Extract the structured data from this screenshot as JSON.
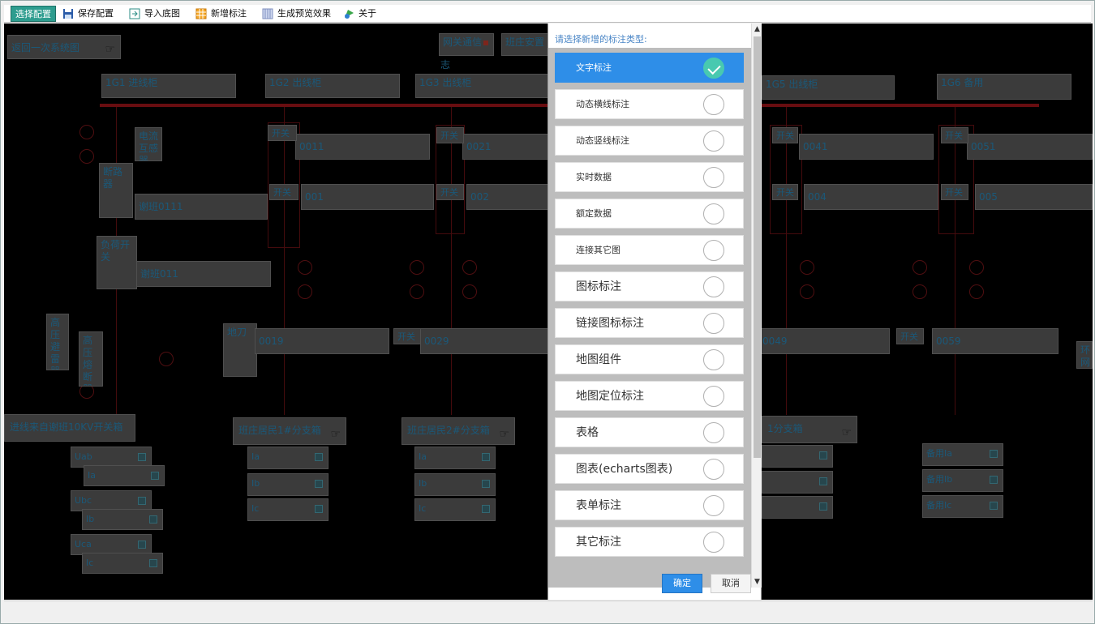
{
  "toolbar": {
    "mode_label": "选择配置",
    "save_label": "保存配置",
    "import_label": "导入底图",
    "add_label": "新增标注",
    "preview_label": "生成预览效果",
    "about_label": "关于"
  },
  "diagram": {
    "back_link": "返回一次系统图",
    "gateway": "网关通信",
    "gateway2": "志",
    "station": "班庄安置",
    "cabinets": [
      "1G1 进线柜",
      "1G2 出线柜",
      "1G3 出线柜",
      "1G5 出线柜",
      "1G6 备用"
    ],
    "codes_a": [
      "0011",
      "0021",
      "0041",
      "0051"
    ],
    "codes_b": [
      "001",
      "002",
      "004",
      "005"
    ],
    "codes_c": [
      "0019",
      "0029",
      "0049",
      "0059"
    ],
    "switch_label": "开关",
    "current_transformer": "电流互感器",
    "breaker": "断路器",
    "load_switch": "负荷开关",
    "xieban0111": "谢班0111",
    "xieban011": "谢班011",
    "hv_arrester": "高压避雷器",
    "hv_fuse": "高压熔断器",
    "ground_knife": "地刀",
    "incoming_box": "进线来自谢班10KV开关箱",
    "branch1": "班庄居民1#分支箱",
    "branch2": "班庄居民2#分支箱",
    "branch4": "1分支箱",
    "ring": "环网",
    "v_left": [
      "Uab",
      "Ia",
      "Ubc",
      "Ib",
      "Uca",
      "Ic"
    ],
    "v_mid": [
      "Ia",
      "Ib",
      "Ic"
    ],
    "v_right": [
      "备用Ia",
      "备用Ib",
      "备用Ic"
    ]
  },
  "dialog": {
    "title": "请选择新增的标注类型:",
    "options": [
      {
        "label": "文字标注",
        "selected": true
      },
      {
        "label": "动态横线标注",
        "selected": false
      },
      {
        "label": "动态竖线标注",
        "selected": false
      },
      {
        "label": "实时数据",
        "selected": false
      },
      {
        "label": "额定数据",
        "selected": false
      },
      {
        "label": "连接其它图",
        "selected": false
      },
      {
        "label": "图标标注",
        "selected": false
      },
      {
        "label": "链接图标标注",
        "selected": false
      },
      {
        "label": "地图组件",
        "selected": false
      },
      {
        "label": "地图定位标注",
        "selected": false
      },
      {
        "label": "表格",
        "selected": false
      },
      {
        "label": "图表(echarts图表)",
        "selected": false
      },
      {
        "label": "表单标注",
        "selected": false
      },
      {
        "label": "其它标注",
        "selected": false
      }
    ],
    "ok_label": "确定",
    "cancel_label": "取消"
  },
  "colors": {
    "accent": "#2e8ee8",
    "check": "#48c9b0",
    "busbar": "#a0141a",
    "canvas": "#000000"
  }
}
